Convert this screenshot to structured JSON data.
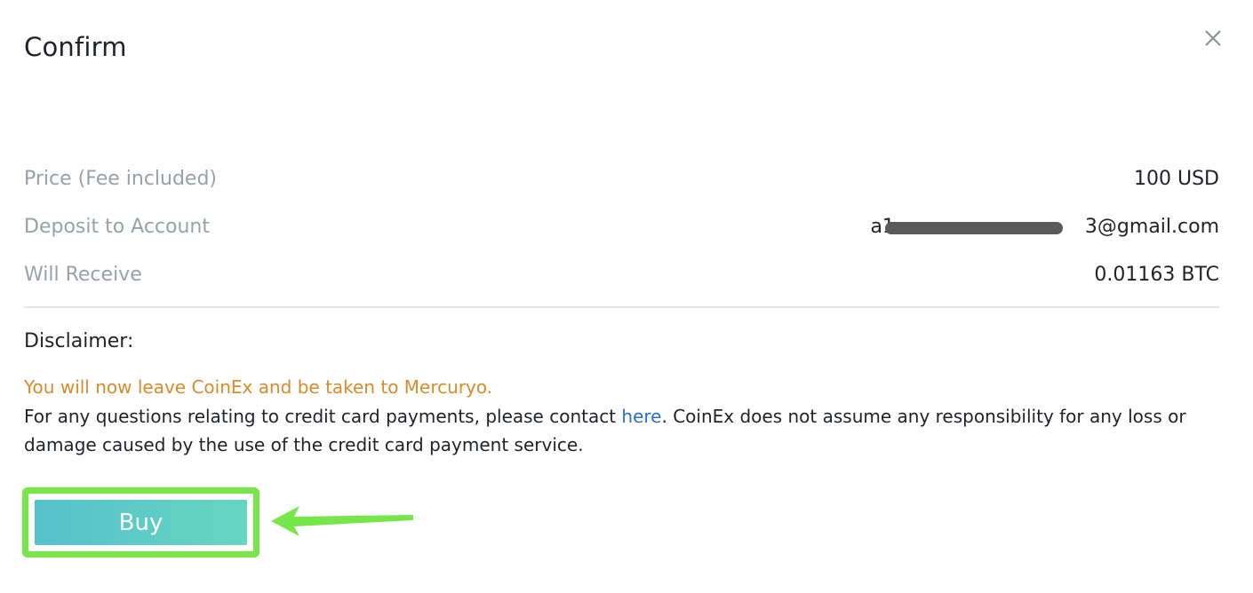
{
  "dialog": {
    "title": "Confirm"
  },
  "details": [
    {
      "label": "Price (Fee included)",
      "value": "100 USD"
    },
    {
      "label": "Deposit to Account",
      "value": "a1xxxxxxxxxxxxx3@gmail.com",
      "value_prefix": "a1",
      "value_suffix": "3@gmail.com",
      "masked": true
    },
    {
      "label": "Will Receive",
      "value": "0.01163 BTC"
    }
  ],
  "disclaimer": {
    "title": "Disclaimer:",
    "warning": "You will now leave CoinEx and be taken to Mercuryo.",
    "text_before_link": "For any questions relating to credit card payments, please contact ",
    "link_text": "here",
    "text_after_link": ". CoinEx does not assume any responsibility for any loss or damage caused by the use of the credit card payment service."
  },
  "actions": {
    "buy_label": "Buy"
  },
  "icons": {
    "close": "close-icon",
    "arrow": "arrow-left-icon"
  },
  "colors": {
    "warning": "#d98b2b",
    "link": "#2a6fd0",
    "button_gradient_start": "#55c1cb",
    "button_gradient_end": "#66d6c1",
    "highlight": "#77e64a"
  }
}
